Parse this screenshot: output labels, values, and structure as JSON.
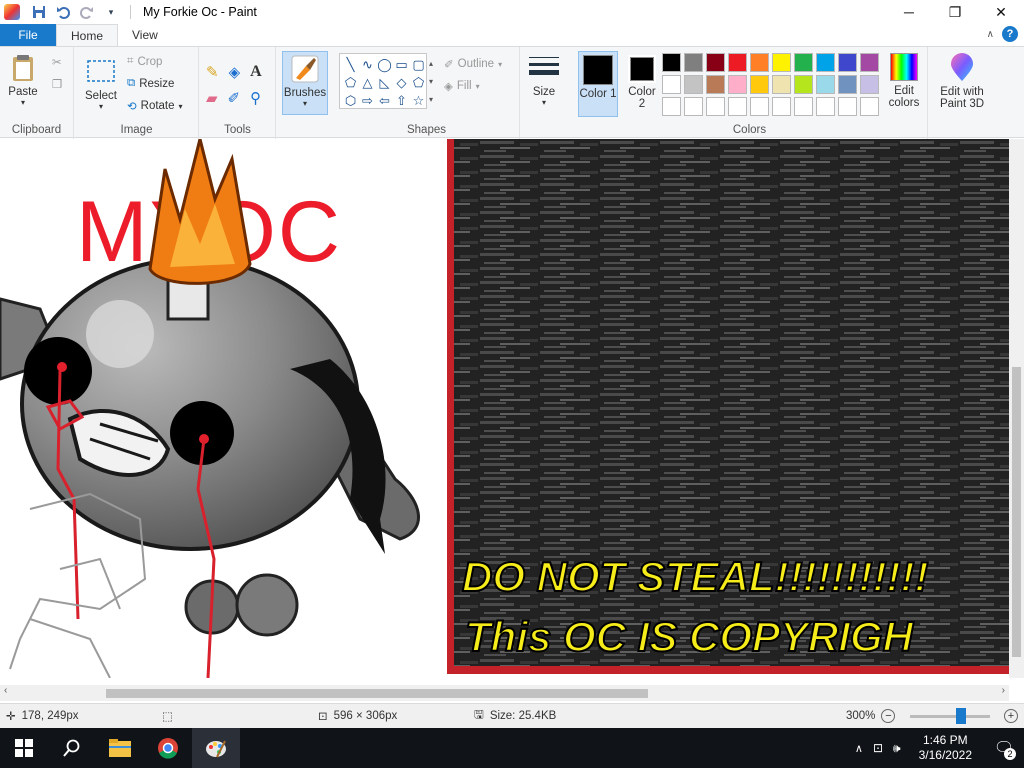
{
  "window": {
    "title": "My Forkie Oc - Paint"
  },
  "tabs": [
    {
      "label": "File"
    },
    {
      "label": "Home"
    },
    {
      "label": "View"
    }
  ],
  "ribbon": {
    "clipboard": {
      "label": "Clipboard",
      "paste": "Paste"
    },
    "image": {
      "label": "Image",
      "select": "Select",
      "crop": "Crop",
      "resize": "Resize",
      "rotate": "Rotate"
    },
    "tools": {
      "label": "Tools"
    },
    "brushes": {
      "label": "Brushes"
    },
    "shapes": {
      "label": "Shapes",
      "outline": "Outline",
      "fill": "Fill"
    },
    "size": {
      "label": "Size"
    },
    "colors": {
      "label": "Colors",
      "color1": "Color 1",
      "color2": "Color 2",
      "edit_colors": "Edit colors",
      "edit_3d": "Edit with Paint 3D",
      "palette": [
        "#000000",
        "#7f7f7f",
        "#880015",
        "#ed1c24",
        "#ff7f27",
        "#fff200",
        "#22b14c",
        "#00a2e8",
        "#3f48cc",
        "#a349a4",
        "#ffffff",
        "#c3c3c3",
        "#b97a57",
        "#ffaec9",
        "#ffc90e",
        "#efe4b0",
        "#b5e61d",
        "#99d9ea",
        "#7092be",
        "#c8bfe7",
        "#ffffff",
        "#ffffff",
        "#ffffff",
        "#ffffff",
        "#ffffff",
        "#ffffff",
        "#ffffff",
        "#ffffff",
        "#ffffff",
        "#ffffff"
      ]
    }
  },
  "canvas": {
    "title_text": "MYOC",
    "warning_line1": "DO NOT STEAL!!!!!!!!!!!",
    "warning_line2": "This OC IS COPYRIGH"
  },
  "status": {
    "cursor": "178, 249px",
    "dimensions": "596 × 306px",
    "size": "Size: 25.4KB",
    "zoom": "300%"
  },
  "taskbar": {
    "time": "1:46 PM",
    "date": "3/16/2022",
    "notifications": "2"
  }
}
